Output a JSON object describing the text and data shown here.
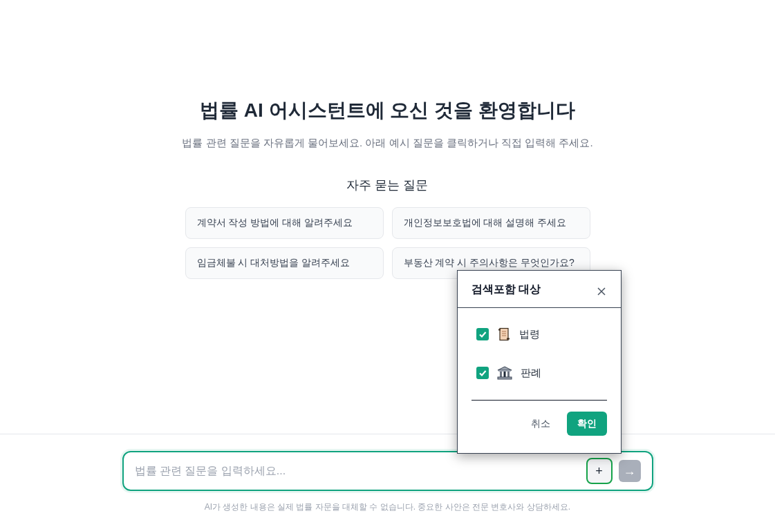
{
  "welcome": {
    "title": "법률 AI 어시스턴트에 오신 것을 환영합니다",
    "subtitle": "법률 관련 질문을 자유롭게 물어보세요. 아래 예시 질문을 클릭하거나 직접 입력해 주세요."
  },
  "faq": {
    "heading": "자주 묻는 질문",
    "questions": [
      "계약서 작성 방법에 대해 알려주세요",
      "개인정보보호법에 대해 설명해 주세요",
      "임금체불 시 대처방법을 알려주세요",
      "부동산 계약 시 주의사항은 무엇인가요?"
    ]
  },
  "search_scope_popup": {
    "title": "검색포함 대상",
    "options": [
      {
        "label": "법령",
        "kind": "statute",
        "checked": true
      },
      {
        "label": "판례",
        "kind": "precedent",
        "checked": true
      }
    ],
    "cancel": "취소",
    "confirm": "확인"
  },
  "composer": {
    "placeholder": "법률 관련 질문을 입력하세요...",
    "add_button": "+",
    "send_button": "→",
    "send_disabled": true
  },
  "disclaimer": "AI가 생성한 내용은 실제 법률 자문을 대체할 수 없습니다. 중요한 사안은 전문 변호사와 상담하세요."
}
